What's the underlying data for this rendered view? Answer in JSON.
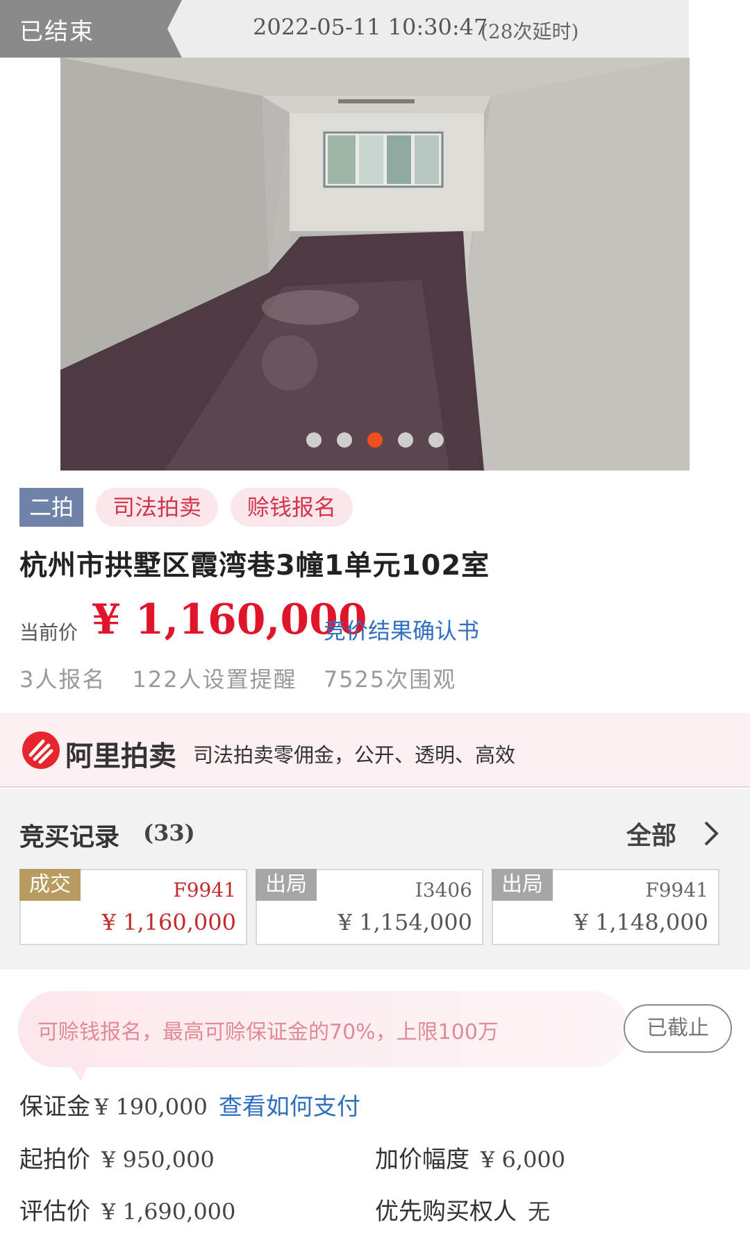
{
  "topbar": {
    "status": "已结束",
    "end_time": "2022-05-11 10:30:47",
    "delay": "(28次延时)"
  },
  "gallery": {
    "image_count": 5,
    "active_index": 2
  },
  "tags": {
    "round": "二拍",
    "type": "司法拍卖",
    "loan": "赊钱报名"
  },
  "property": {
    "title": "杭州市拱墅区霞湾巷3幢1单元102室"
  },
  "price": {
    "label": "当前价",
    "value": "¥ 1,160,000",
    "confirm_link": "竞价结果确认书"
  },
  "stats": {
    "signups": "3人报名",
    "reminders": "122人设置提醒",
    "views": "7525次围观"
  },
  "ali_banner": {
    "brand": "阿里拍卖",
    "slogan": "司法拍卖零佣金，公开、透明、高效"
  },
  "bid_records": {
    "title": "竞买记录",
    "count": "(33)",
    "all_label": "全部",
    "items": [
      {
        "status": "成交",
        "bidder": "F9941",
        "amount": "¥ 1,160,000"
      },
      {
        "status": "出局",
        "bidder": "I3406",
        "amount": "¥ 1,154,000"
      },
      {
        "status": "出局",
        "bidder": "F9941",
        "amount": "¥ 1,148,000"
      }
    ]
  },
  "loan_banner": {
    "text": "可赊钱报名，最高可赊保证金的70%，上限100万",
    "button": "已截止"
  },
  "deposit": {
    "label": "保证金",
    "value": "¥ 190,000",
    "link": "查看如何支付"
  },
  "details": {
    "start_price_label": "起拍价",
    "start_price": "¥ 950,000",
    "increment_label": "加价幅度",
    "increment": "¥ 6,000",
    "appraisal_label": "评估价",
    "appraisal": "¥ 1,690,000",
    "priority_label": "优先购买权人",
    "priority": "无"
  },
  "colors": {
    "price_red": "#e0142a",
    "link_blue": "#2f6fbf",
    "active_dot": "#f0501e",
    "deal_gold": "#b89b5e"
  }
}
